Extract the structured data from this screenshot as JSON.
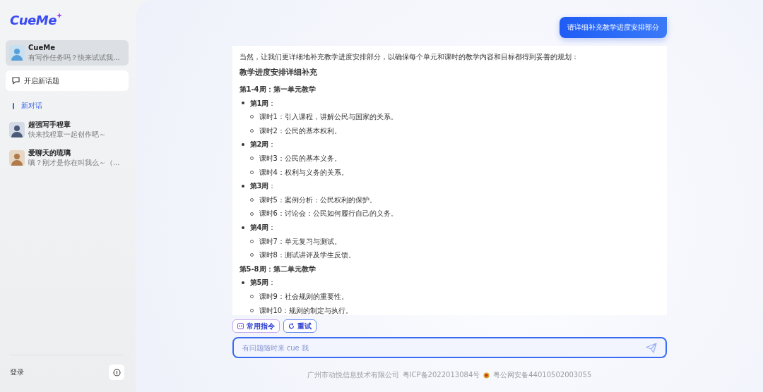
{
  "sidebar": {
    "logo": "CueMe",
    "active_bot": {
      "name": "CueMe",
      "preview": "有写作任务吗？快来试试我..."
    },
    "new_topic_button": "开启新话题",
    "tabs": [
      {
        "label": "新对话",
        "selected": true
      }
    ],
    "chats": [
      {
        "name": "超强写手程章",
        "preview": "快来找程章一起创作吧～"
      },
      {
        "name": "爱聊天的琉璃",
        "preview": "嗔？刚才是你在叫我么～（..."
      }
    ],
    "login": "登录"
  },
  "chat": {
    "user_message": "请详细补充教学进度安排部分",
    "answer": [
      {
        "kind": "paragraph",
        "text": "当然，让我们更详细地补充教学进度安排部分，以确保每个单元和课时的教学内容和目标都得到妥善的规划："
      },
      {
        "kind": "heading",
        "text": "教学进度安排详细补充"
      },
      {
        "kind": "section",
        "text": "第1-4周：第一单元教学"
      },
      {
        "kind": "week",
        "text": "**第1周**："
      },
      {
        "kind": "lesson",
        "text": "课时1：引入课程，讲解公民与国家的关系。"
      },
      {
        "kind": "lesson",
        "text": "课时2：公民的基本权利。"
      },
      {
        "kind": "week",
        "text": "**第2周**："
      },
      {
        "kind": "lesson",
        "text": "课时3：公民的基本义务。"
      },
      {
        "kind": "lesson",
        "text": "课时4：权利与义务的关系。"
      },
      {
        "kind": "week",
        "text": "**第3周**："
      },
      {
        "kind": "lesson",
        "text": "课时5：案例分析：公民权利的保护。"
      },
      {
        "kind": "lesson",
        "text": "课时6：讨论会：公民如何履行自己的义务。"
      },
      {
        "kind": "week",
        "text": "**第4周**："
      },
      {
        "kind": "lesson",
        "text": "课时7：单元复习与测试。"
      },
      {
        "kind": "lesson",
        "text": "课时8：测试讲评及学生反馈。"
      },
      {
        "kind": "section",
        "text": "第5-8周：第二单元教学"
      },
      {
        "kind": "week",
        "text": "**第5周**："
      },
      {
        "kind": "lesson",
        "text": "课时9：社会规则的重要性。"
      },
      {
        "kind": "lesson",
        "text": "课时10：规则的制定与执行。"
      }
    ],
    "chips": [
      {
        "kind": "commands",
        "label": "常用指令"
      },
      {
        "kind": "retry",
        "label": "重试"
      }
    ],
    "input": {
      "placeholder": "有问题随时来 cue 我"
    }
  },
  "footer": {
    "company": "广州市动悦信息技术有限公司",
    "icp": "粤ICP备2022013084号",
    "police": "粤公网安备44010502003055"
  }
}
